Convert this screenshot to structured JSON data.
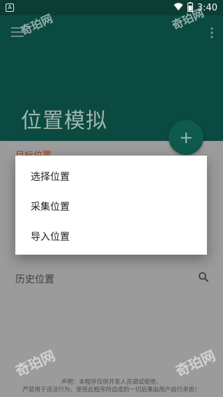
{
  "status_bar": {
    "app_icon_letter": "A",
    "time": "3:40"
  },
  "header": {
    "title": "位置模拟"
  },
  "fab": {
    "label": "+"
  },
  "target_card": {
    "label": "目标位置"
  },
  "history": {
    "label": "历史位置"
  },
  "dialog": {
    "items": [
      {
        "label": "选择位置"
      },
      {
        "label": "采集位置"
      },
      {
        "label": "导入位置"
      }
    ]
  },
  "disclaimer": {
    "line1": "声明：本程序仅供开发人员调试使用，",
    "line2": "严禁用于违法行为，使用此程序所造成的一切后果由用户自行承担！"
  },
  "watermark": "奇珀网",
  "colors": {
    "header_bg": "#0b4a40",
    "status_bg": "#0b3d34",
    "accent_label": "#a1421f"
  }
}
